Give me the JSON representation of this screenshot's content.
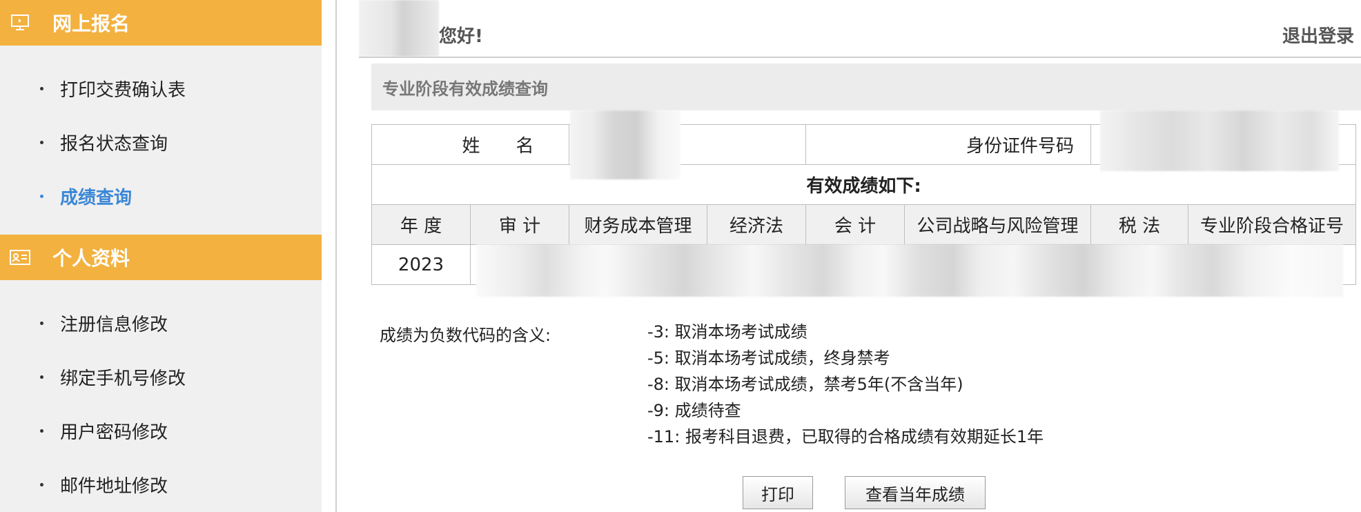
{
  "sidebar": {
    "sections": [
      {
        "title": "网上报名",
        "icon": "monitor-icon",
        "items": [
          {
            "label": "打印交费确认表",
            "active": false
          },
          {
            "label": "报名状态查询",
            "active": false
          },
          {
            "label": "成绩查询",
            "active": true
          }
        ]
      },
      {
        "title": "个人资料",
        "icon": "profile-card-icon",
        "items": [
          {
            "label": "注册信息修改",
            "active": false
          },
          {
            "label": "绑定手机号修改",
            "active": false
          },
          {
            "label": "用户密码修改",
            "active": false
          },
          {
            "label": "邮件地址修改",
            "active": false
          }
        ]
      }
    ]
  },
  "header": {
    "greeting": "您好!",
    "logout": "退出登录"
  },
  "panel": {
    "title": "专业阶段有效成绩查询"
  },
  "score_table": {
    "name_label": "姓　　名",
    "id_label": "身份证件号码",
    "subtitle": "有效成绩如下:",
    "columns": [
      "年 度",
      "审 计",
      "财务成本管理",
      "经济法",
      "会 计",
      "公司战略与风险管理",
      "税 法",
      "专业阶段合格证号"
    ],
    "row": {
      "year": "2023"
    }
  },
  "legend": {
    "label": "成绩为负数代码的含义:",
    "lines": [
      "-3: 取消本场考试成绩",
      "-5: 取消本场考试成绩，终身禁考",
      "-8: 取消本场考试成绩，禁考5年(不含当年)",
      "-9: 成绩待查",
      "-11: 报考科目退费，已取得的合格成绩有效期延长1年"
    ]
  },
  "buttons": {
    "print": "打印",
    "view_current": "查看当年成绩"
  },
  "colors": {
    "accent": "#f3b13f",
    "active_link": "#3b87d6"
  }
}
